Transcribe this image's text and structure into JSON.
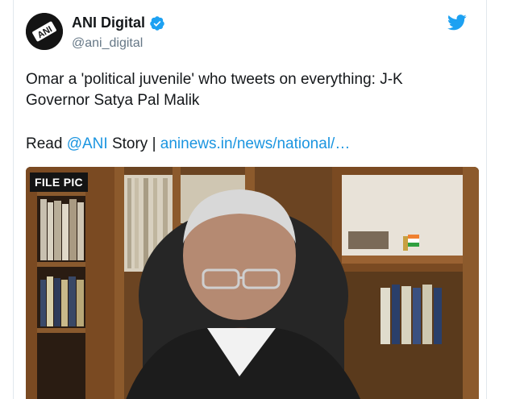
{
  "tweet": {
    "author": {
      "display_name": "ANI Digital",
      "handle": "@ani_digital",
      "verified": true,
      "avatar_text": "ANI"
    },
    "text": "Omar a 'political juvenile' who tweets on everything: J-K Governor Satya Pal Malik",
    "read_prefix": "Read ",
    "mention": "@ANI",
    "story_sep": " Story | ",
    "story_link": "aninews.in/news/national/…",
    "media": {
      "badge": "FILE PIC"
    }
  },
  "colors": {
    "link": "#1b95e0",
    "verified": "#1da1f2",
    "twitter_bird": "#1da1f2",
    "handle": "#657786"
  },
  "icons": [
    "avatar-logo",
    "verified-badge-icon",
    "twitter-bird-icon"
  ]
}
